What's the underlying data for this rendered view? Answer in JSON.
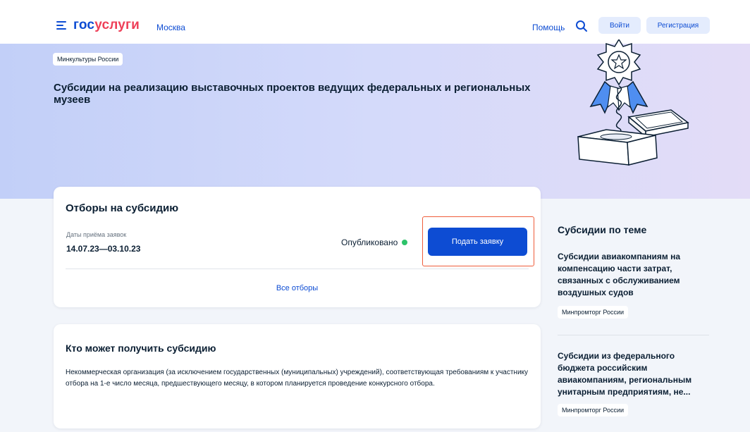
{
  "header": {
    "logo_part1": "гос",
    "logo_part2": "услуги",
    "city": "Москва",
    "help": "Помощь",
    "login": "Войти",
    "register": "Регистрация"
  },
  "banner": {
    "department": "Минкультуры России",
    "title": "Субсидии на реализацию выставочных проектов ведущих федеральных и региональных музеев"
  },
  "selection": {
    "title": "Отборы на субсидию",
    "dates_label": "Даты приёма заявок",
    "dates_value": "14.07.23—03.10.23",
    "status": "Опубликовано",
    "apply_button": "Подать заявку",
    "all_link": "Все отборы"
  },
  "who": {
    "title": "Кто может получить субсидию",
    "text": "Некоммерческая организация (за исключением государственных (муниципальных) учреждений), соответствующая требованиям к участнику отбора на 1-е число месяца, предшествующего месяцу, в котором планируется проведение конкурсного отбора."
  },
  "sidebar": {
    "heading": "Субсидии по теме",
    "items": [
      {
        "title": "Субсидии авиакомпаниям на компенсацию части затрат, связанных с обслуживанием воздушных судов",
        "tag": "Минпромторг России"
      },
      {
        "title": "Субсидии из федерального бюджета российским авиакомпаниям, региональным унитарным предприятиям, не...",
        "tag": "Минпромторг России"
      }
    ]
  },
  "colors": {
    "brand_blue": "#0d4cd3",
    "brand_red": "#ee3f58",
    "status_green": "#2dc36a",
    "highlight_orange": "#ef5d3b"
  },
  "icons": [
    "menu-icon",
    "search-icon",
    "status-dot-icon",
    "award-box-illustration"
  ]
}
